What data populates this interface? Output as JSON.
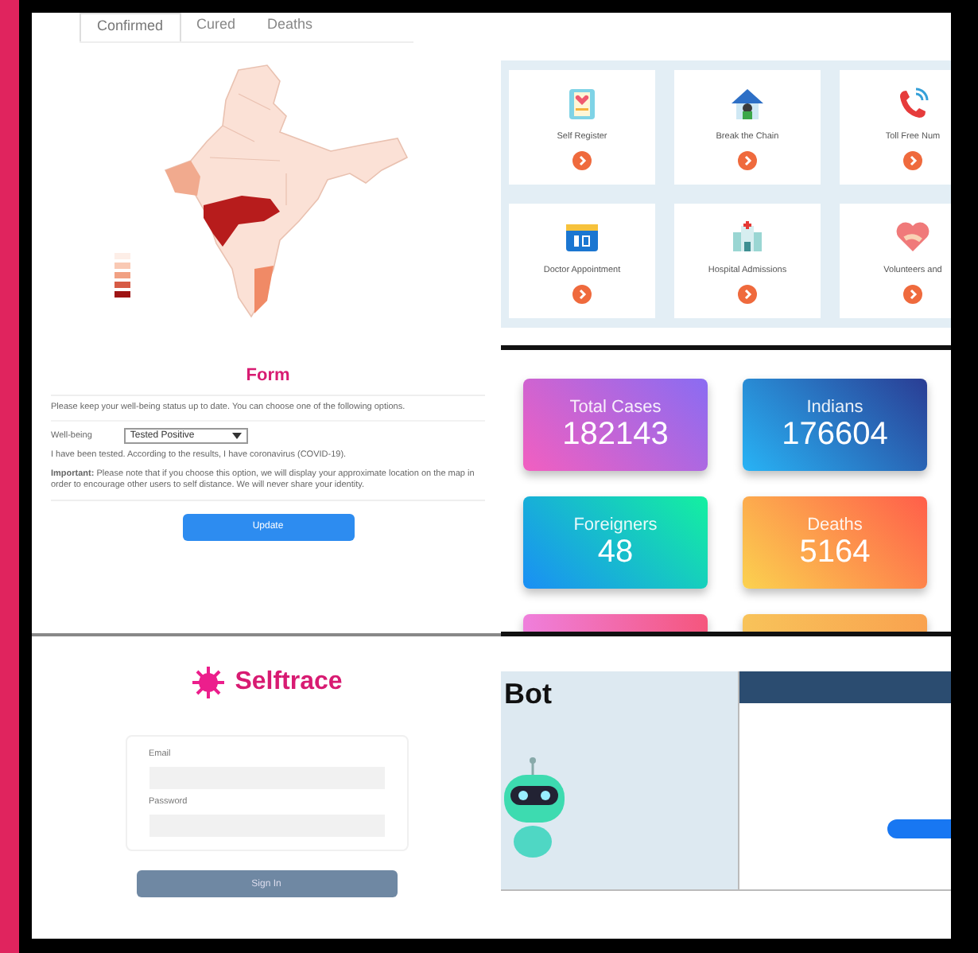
{
  "map_panel": {
    "tabs": [
      {
        "label": "Confirmed",
        "selected": true
      },
      {
        "label": "Cured",
        "selected": false
      },
      {
        "label": "Deaths",
        "selected": false
      }
    ]
  },
  "services": [
    {
      "label": "Self Register",
      "kind": "clipboard"
    },
    {
      "label": "Break the Chain",
      "kind": "house"
    },
    {
      "label": "Toll Free Num",
      "kind": "phone"
    },
    {
      "label": "Doctor Appointment",
      "kind": "calendar"
    },
    {
      "label": "Hospital Admissions",
      "kind": "hospital"
    },
    {
      "label": "Volunteers and",
      "kind": "heart"
    }
  ],
  "form": {
    "title": "Form",
    "intro": "Please keep your well-being status up to date. You can choose one of the following options.",
    "field_label": "Well-being",
    "field_value": "Tested Positive",
    "status_text": "I have been tested. According to the results, I have coronavirus (COVID-19).",
    "note": "**Important:** Please note that if you choose this option, we will display your approximate location on the map in order to encourage other users to self distance. We will never share your identity.",
    "button": "Update"
  },
  "stats": [
    {
      "label": "Total Cases",
      "value": "182143",
      "kind": "violet"
    },
    {
      "label": "Indians",
      "value": "176604",
      "kind": "blue"
    },
    {
      "label": "Foreigners",
      "value": "48",
      "kind": "teal"
    },
    {
      "label": "Deaths",
      "value": "5164",
      "kind": "orange"
    }
  ],
  "login": {
    "brand": "Selftrace",
    "email_label": "Email",
    "password_label": "Password",
    "button": "Sign In"
  },
  "chatbot": {
    "title": "Bot"
  }
}
